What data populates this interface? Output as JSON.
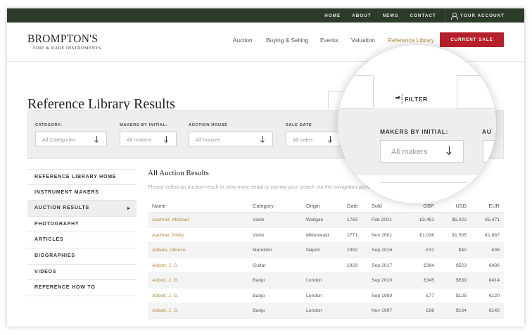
{
  "topnav": {
    "links": [
      "HOME",
      "ABOUT",
      "NEWS",
      "CONTACT"
    ],
    "account": "YOUR ACCOUNT"
  },
  "logo": {
    "main": "BROMPTON'S",
    "sub": "FINE & RARE INSTRUMENTS"
  },
  "mainnav": {
    "items": [
      "Auction",
      "Buying & Selling",
      "Events",
      "Valuation",
      "Reference Library"
    ],
    "active": "Reference Library",
    "cta": "CURRENT SALE"
  },
  "page_title": "Reference Library Results",
  "filters": [
    {
      "label": "CATEGORY:",
      "value": "All Categories"
    },
    {
      "label": "MAKERS BY INITIAL:",
      "value": "All makers"
    },
    {
      "label": "AUCTION HOUSE",
      "value": "All houses"
    },
    {
      "label": "SALE DATE",
      "value": "All sales"
    }
  ],
  "magnifier": {
    "tab_label": "FILTER",
    "filter_label": "MAKERS BY INITIAL:",
    "filter_value": "All makers",
    "next_label_fragment": "AU"
  },
  "sidebar": {
    "items": [
      "REFERENCE LIBRARY HOME",
      "INSTRUMENT MAKERS",
      "AUCTION RESULTS",
      "PHOTOGRAPHY",
      "ARTICLES",
      "BIOGRAPHIES",
      "VIDEOS",
      "REFERENCE HOW TO"
    ],
    "active": "AUCTION RESULTS"
  },
  "results": {
    "title": "All Auction Results",
    "description": "Please select an auction result to view more detail or narrow your search via the navigation above.",
    "columns": [
      "Name",
      "Category",
      "Origin",
      "Date",
      "Sold",
      "GBP",
      "USD",
      "EUR"
    ],
    "rows": [
      [
        "Aachner, Michael",
        "Violin",
        "Wallgan",
        "1763",
        "Feb 2001",
        "£3,451",
        "$5,022",
        "€5,471"
      ],
      [
        "Aachner, Philip",
        "Violin",
        "Mittenwald",
        "1771",
        "Nov 2001",
        "£1,036",
        "$1,505",
        "€1,687"
      ],
      [
        "Abbate, Alfonso",
        "Mandolin",
        "Napoli",
        "1902",
        "Sep 2016",
        "£31",
        "$40",
        "€36"
      ],
      [
        "Abbott, J. G.",
        "Guitar",
        "",
        "1929",
        "Sep 2017",
        "£384",
        "$523",
        "€436"
      ],
      [
        "Abbott, J. G.",
        "Banjo",
        "London",
        "",
        "Sep 2010",
        "£345",
        "$539",
        "€414"
      ],
      [
        "Abbott, J. G.",
        "Banjo",
        "London",
        "",
        "Sep 1999",
        "£77",
        "$125",
        "€120"
      ],
      [
        "Abbott, J. G.",
        "Banjo",
        "London",
        "",
        "Nov 1997",
        "£98",
        "$164",
        "€145"
      ]
    ]
  }
}
